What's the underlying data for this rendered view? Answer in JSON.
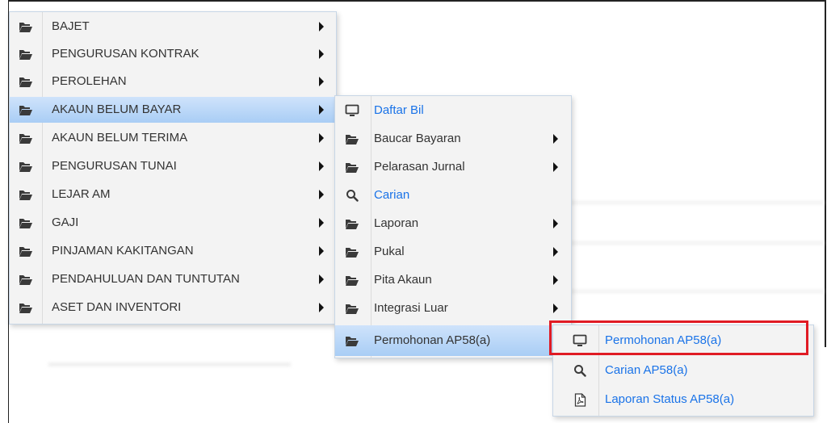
{
  "colors": {
    "menu_bg": "#f3f3f3",
    "active_bg": "#a9cdf5",
    "link_text": "#1a73e8",
    "text": "#333333",
    "highlight_border": "#e01b24"
  },
  "main_menu": {
    "items": [
      {
        "label": "BAJET",
        "icon": "folder-icon"
      },
      {
        "label": "PENGURUSAN KONTRAK",
        "icon": "folder-icon"
      },
      {
        "label": "PEROLEHAN",
        "icon": "folder-icon"
      },
      {
        "label": "AKAUN BELUM BAYAR",
        "icon": "folder-icon",
        "active": true
      },
      {
        "label": "AKAUN BELUM TERIMA",
        "icon": "folder-icon"
      },
      {
        "label": "PENGURUSAN TUNAI",
        "icon": "folder-icon"
      },
      {
        "label": "LEJAR AM",
        "icon": "folder-icon"
      },
      {
        "label": "GAJI",
        "icon": "folder-icon"
      },
      {
        "label": "PINJAMAN KAKITANGAN",
        "icon": "folder-icon"
      },
      {
        "label": "PENDAHULUAN DAN TUNTUTAN",
        "icon": "folder-icon"
      },
      {
        "label": "ASET DAN INVENTORI",
        "icon": "folder-icon"
      }
    ]
  },
  "submenu": {
    "items": [
      {
        "label": "Daftar Bil",
        "icon": "monitor-icon"
      },
      {
        "label": "Baucar Bayaran",
        "icon": "folder-icon"
      },
      {
        "label": "Pelarasan Jurnal",
        "icon": "folder-icon"
      },
      {
        "label": "Carian",
        "icon": "search-icon"
      },
      {
        "label": "Laporan",
        "icon": "folder-icon"
      },
      {
        "label": "Pukal",
        "icon": "folder-icon"
      },
      {
        "label": "Pita Akaun",
        "icon": "folder-icon"
      },
      {
        "label": "Integrasi Luar",
        "icon": "folder-icon"
      },
      {
        "label": "Permohonan AP58(a)",
        "icon": "folder-icon",
        "active": true
      }
    ]
  },
  "sub_submenu": {
    "items": [
      {
        "label": "Permohonan AP58(a)",
        "icon": "monitor-icon"
      },
      {
        "label": "Carian AP58(a)",
        "icon": "search-icon"
      },
      {
        "label": "Laporan Status AP58(a)",
        "icon": "pdf-icon"
      }
    ]
  }
}
